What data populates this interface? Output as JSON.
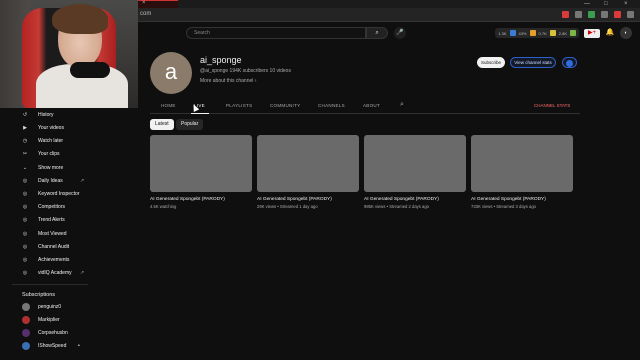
{
  "browser": {
    "tab_close": "×",
    "url": "com",
    "window_controls": [
      "—",
      "□",
      "×"
    ]
  },
  "masthead": {
    "search_placeholder": "Search",
    "search_icon": "⌕",
    "mic_icon": "🎤",
    "vidiq_stats": [
      "1.3K",
      "43%",
      "0.7K",
      "2.8K"
    ],
    "create_icon": "▶+",
    "bell_icon": "🔔",
    "avatar_text": "◐"
  },
  "channel": {
    "avatar_letter": "a",
    "name": "ai_sponge",
    "meta": "@ai_sponge    194K subscribers   10 videos",
    "more": "More about this channel  ›",
    "subscribe": "Subscribe",
    "view_stats": "View channel stats",
    "avatar_color": "#8a7b6a"
  },
  "tabs": {
    "home": "HOME",
    "live": "LIVE",
    "playlists": "PLAYLISTS",
    "community": "COMMUNITY",
    "channels": "CHANNELS",
    "about": "ABOUT",
    "search_icon": "⌕",
    "analytics": "CHANNEL STATS"
  },
  "chips": {
    "latest": "Latest",
    "popular": "Popular"
  },
  "videos": [
    {
      "title": "AI Generated Spongebt (PARODY)",
      "meta": "4.5K watching"
    },
    {
      "title": "AI Generated Spongebt (PARODY)",
      "meta": "29K views • Streamed 1 day ago"
    },
    {
      "title": "AI Generated Spongebt (PARODY)",
      "meta": "985K views • Streamed 2 days ago"
    },
    {
      "title": "AI Generated Spongebt (PARODY)",
      "meta": "733K views • Streamed 3 days ago"
    }
  ],
  "sidebar": {
    "items": [
      {
        "label": "History",
        "icon": "↺"
      },
      {
        "label": "Your videos",
        "icon": "▶"
      },
      {
        "label": "Watch later",
        "icon": "◷"
      },
      {
        "label": "Your clips",
        "icon": "✂"
      },
      {
        "label": "Show more",
        "icon": "⌄"
      },
      {
        "label": "Daily Ideas",
        "icon": "◎",
        "ext": "↗"
      },
      {
        "label": "Keyword Inspector",
        "icon": "◎"
      },
      {
        "label": "Competitors",
        "icon": "◎"
      },
      {
        "label": "Trend Alerts",
        "icon": "◎"
      },
      {
        "label": "Most Viewed",
        "icon": "◎"
      },
      {
        "label": "Channel Audit",
        "icon": "◎"
      },
      {
        "label": "Achievements",
        "icon": "◎"
      },
      {
        "label": "vidIQ Academy",
        "icon": "◎",
        "ext": "↗"
      }
    ],
    "subscriptions_heading": "Subscriptions",
    "subscriptions": [
      {
        "name": "penguinz0",
        "color": "#777777"
      },
      {
        "name": "Markiplier",
        "color": "#b03030"
      },
      {
        "name": "Corpsehusbn",
        "color": "#552f6e"
      },
      {
        "name": "IShowSpeed",
        "color": "#3a6fb0",
        "dot": "•"
      }
    ]
  }
}
